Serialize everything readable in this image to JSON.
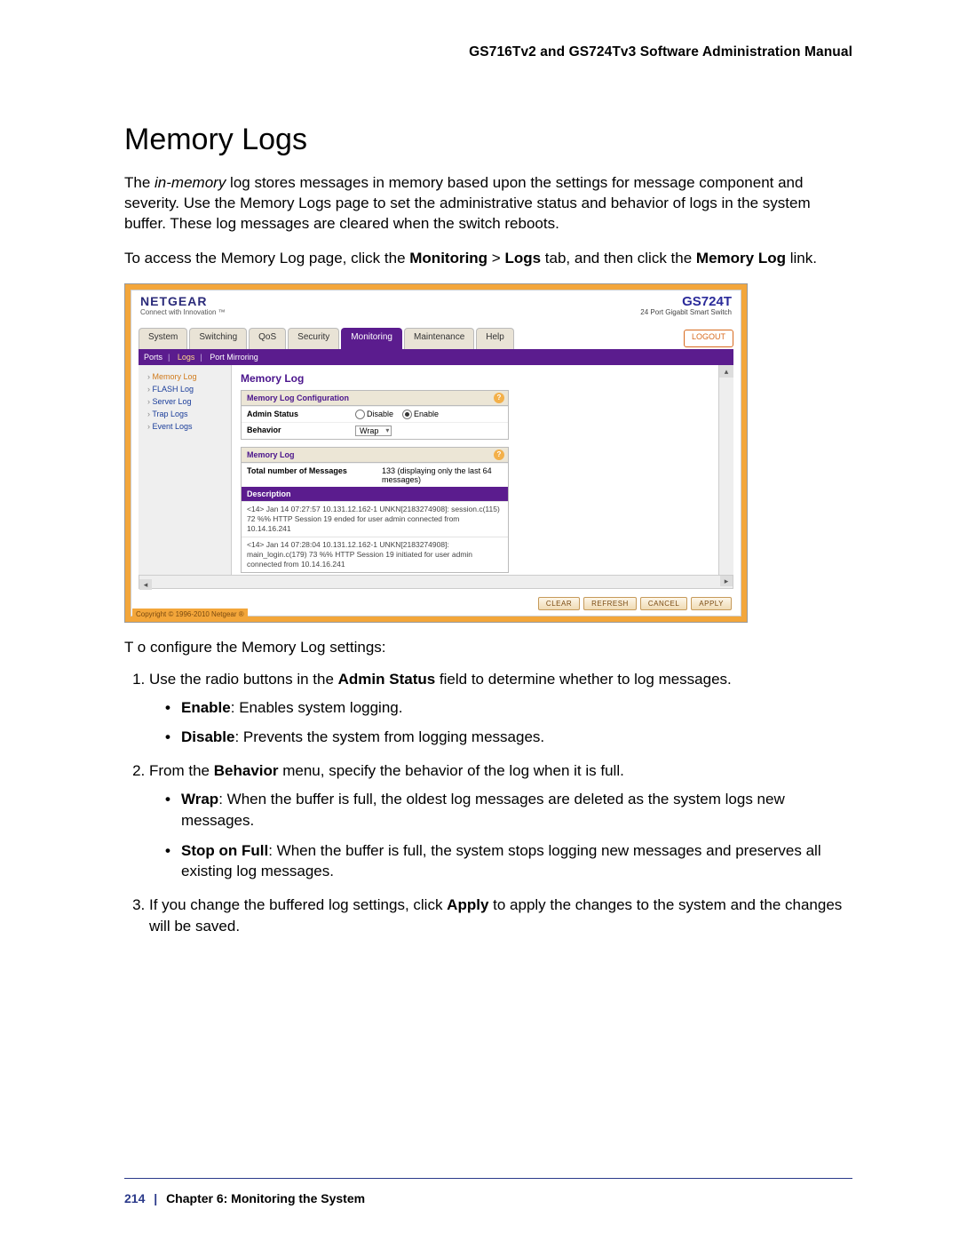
{
  "header": {
    "running": "GS716Tv2 and GS724Tv3 Software Administration Manual"
  },
  "title": "Memory Logs",
  "intro": {
    "p1_a": "The ",
    "p1_em": "in-memory",
    "p1_b": " log stores messages in memory based upon the settings for message component and severity. Use the Memory Logs page to set the administrative status and behavior of logs in the system buffer. These log messages are cleared when the switch reboots.",
    "p2_a": "To access the Memory Log page, click the ",
    "p2_b1": "Monitoring",
    "p2_gt": " > ",
    "p2_b2": "Logs",
    "p2_c": " tab, and then click the ",
    "p2_b3": "Memory Log",
    "p2_d": " link."
  },
  "screenshot": {
    "brand": "NETGEAR",
    "tagline": "Connect with Innovation ™",
    "model": "GS724T",
    "model_sub": "24 Port Gigabit Smart Switch",
    "tabs": [
      "System",
      "Switching",
      "QoS",
      "Security",
      "Monitoring",
      "Maintenance",
      "Help"
    ],
    "active_tab": "Monitoring",
    "logout": "LOGOUT",
    "subnav": {
      "items": [
        "Ports",
        "Logs",
        "Port Mirroring"
      ],
      "active": "Logs"
    },
    "sidebar": [
      "Memory Log",
      "FLASH Log",
      "Server Log",
      "Trap Logs",
      "Event Logs"
    ],
    "sidebar_active": "Memory Log",
    "main_heading": "Memory Log",
    "panel1": {
      "title": "Memory Log Configuration",
      "admin_label": "Admin Status",
      "disable": "Disable",
      "enable": "Enable",
      "behavior_label": "Behavior",
      "behavior_value": "Wrap"
    },
    "panel2": {
      "title": "Memory Log",
      "total_label": "Total number of Messages",
      "total_value": "133 (displaying only the last 64 messages)",
      "desc_head": "Description",
      "row1": "<14> Jan 14 07:27:57 10.131.12.162-1 UNKN[2183274908]: session.c(115) 72 %% HTTP Session 19 ended for user admin connected from 10.14.16.241",
      "row2": "<14> Jan 14 07:28:04 10.131.12.162-1 UNKN[2183274908]: main_login.c(179) 73 %% HTTP Session 19 initiated for user admin connected from 10.14.16.241"
    },
    "buttons": [
      "CLEAR",
      "REFRESH",
      "CANCEL",
      "APPLY"
    ],
    "copyright": "Copyright © 1996-2010 Netgear ®"
  },
  "after_shot": "T o configure the Memory Log settings:",
  "steps": {
    "s1_a": "Use the radio buttons in the ",
    "s1_b": "Admin Status",
    "s1_c": " field to determine whether to log messages.",
    "s1_bullets": [
      {
        "b": "Enable",
        "t": ": Enables system logging."
      },
      {
        "b": "Disable",
        "t": ": Prevents the system from logging messages."
      }
    ],
    "s2_a": "From the ",
    "s2_b": "Behavior",
    "s2_c": " menu, specify the behavior of the log when it is full.",
    "s2_bullets": [
      {
        "b": "Wrap",
        "t": ": When the buffer is full, the oldest log messages are deleted as the system logs new messages."
      },
      {
        "b": "Stop on Full",
        "t": ": When the buffer is full, the system stops logging new messages and preserves all existing log messages."
      }
    ],
    "s3_a": "If you change the buffered log settings, click ",
    "s3_b": "Apply",
    "s3_c": " to apply the changes to the system and the changes will be saved."
  },
  "footer": {
    "page": "214",
    "sep": "|",
    "text": "Chapter 6:  Monitoring the System"
  }
}
